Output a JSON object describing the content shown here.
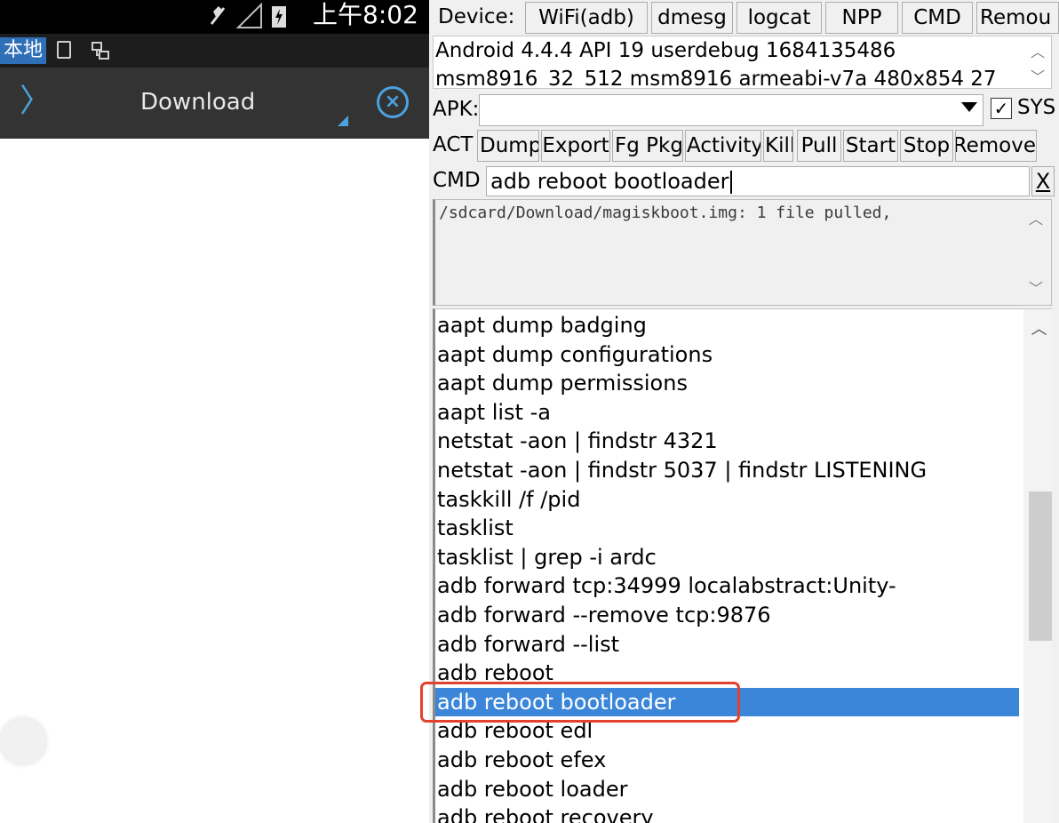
{
  "android": {
    "status_time": "上午8:02",
    "tab_local": "本地",
    "title": "Download",
    "chevron": "〉",
    "close": "×"
  },
  "tool": {
    "device_label": "Device:",
    "device_buttons": [
      "WiFi(adb)",
      "dmesg",
      "logcat",
      "NPP",
      "CMD",
      "Remou"
    ],
    "device_info": [
      "Android 4.4.4 API 19 userdebug 1684135486",
      "msm8916_32_512 msm8916 armeabi-v7a 480x854 27"
    ],
    "apk_label": "APK:",
    "apk_value": "",
    "sys_label": "SYS",
    "sys_checked": "✓",
    "act_label": "ACT",
    "act_buttons": [
      "Dump",
      "Export",
      "Fg Pkg",
      "Activity",
      "Kill",
      "Pull",
      "Start",
      "Stop",
      "Remove"
    ],
    "cmd_label": "CMD",
    "cmd_value": "adb reboot bootloader",
    "cmd_clear": "X",
    "output_text": "/sdcard/Download/magiskboot.img: 1 file pulled,",
    "commands": [
      "aapt dump badging",
      "aapt dump configurations",
      "aapt dump permissions",
      "aapt list -a",
      "netstat -aon | findstr 4321",
      "netstat -aon | findstr 5037 | findstr LISTENING",
      "taskkill /f /pid",
      "tasklist",
      "tasklist | grep -i ardc",
      "adb forward tcp:34999 localabstract:Unity-",
      "adb forward --remove tcp:9876",
      "adb forward --list",
      "adb reboot",
      "adb reboot bootloader",
      "adb reboot edl",
      "adb reboot efex",
      "adb reboot loader",
      "adb reboot recovery"
    ],
    "selected_command": "adb reboot bootloader",
    "highlight_color": "#e3412f",
    "selection_color": "#3b86d9",
    "scroll_up": "︿",
    "scroll_down": "﹀"
  }
}
